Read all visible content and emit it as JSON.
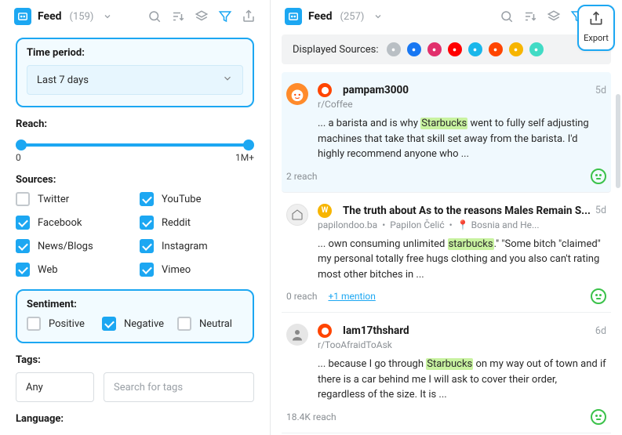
{
  "left": {
    "feed_label": "Feed",
    "feed_count": "(159)",
    "time_period": {
      "label": "Time period:",
      "value": "Last 7 days"
    },
    "reach": {
      "label": "Reach:",
      "min": "0",
      "max": "1M+"
    },
    "sources_label": "Sources:",
    "sources": [
      {
        "label": "Twitter",
        "checked": false
      },
      {
        "label": "YouTube",
        "checked": true
      },
      {
        "label": "Facebook",
        "checked": true
      },
      {
        "label": "Reddit",
        "checked": true
      },
      {
        "label": "News/Blogs",
        "checked": true
      },
      {
        "label": "Instagram",
        "checked": true
      },
      {
        "label": "Web",
        "checked": true
      },
      {
        "label": "Vimeo",
        "checked": true
      }
    ],
    "sentiment": {
      "label": "Sentiment:",
      "items": [
        {
          "label": "Positive",
          "checked": false
        },
        {
          "label": "Negative",
          "checked": true
        },
        {
          "label": "Neutral",
          "checked": false
        }
      ]
    },
    "tags": {
      "label": "Tags:",
      "select_value": "Any",
      "search_placeholder": "Search for tags"
    },
    "language_label": "Language:"
  },
  "right": {
    "feed_label": "Feed",
    "feed_count": "(257)",
    "displayed_sources_label": "Displayed Sources:",
    "export_label": "Export",
    "source_colors": [
      "#b9bfc4",
      "#1877f2",
      "#e1306c",
      "#ff0000",
      "#1ab7ea",
      "#ff4500",
      "#f7b500",
      "#41dbc5"
    ],
    "posts": [
      {
        "kind": "reddit",
        "username": "pampam3000",
        "sub": "r/Coffee",
        "age": "5d",
        "text_pre": "... a barista and is why ",
        "keyword": "Starbucks",
        "text_post": " went to fully self adjusting machines that take that skill set away from the barista. I'd highly recommend anyone who ...",
        "reach": "2 reach",
        "mention": ""
      },
      {
        "kind": "web",
        "username": "The truth about As to the reasons Males Remain S...",
        "sub": "",
        "age": "5d",
        "meta_site": "papilondoo.ba",
        "meta_author": "Papilon Čelić",
        "meta_location": "Bosnia and He...",
        "text_pre": "... own consuming unlimited ",
        "keyword": "starbucks",
        "text_post": ".\" \"Some bitch \"claimed\" my personal totally free hugs clothing and you also can't rating most other bitches in ...",
        "reach": "0 reach",
        "mention": "+1 mention"
      },
      {
        "kind": "reddit",
        "username": "Iam17thshard",
        "sub": "r/TooAfraidToAsk",
        "age": "6d",
        "text_pre": "... because I go through ",
        "keyword": "Starbucks",
        "text_post": " on my way out of town and if there is a car behind me I will ask to cover their order, regardless of the size. It is ...",
        "reach": "18.4K reach",
        "mention": ""
      }
    ]
  }
}
